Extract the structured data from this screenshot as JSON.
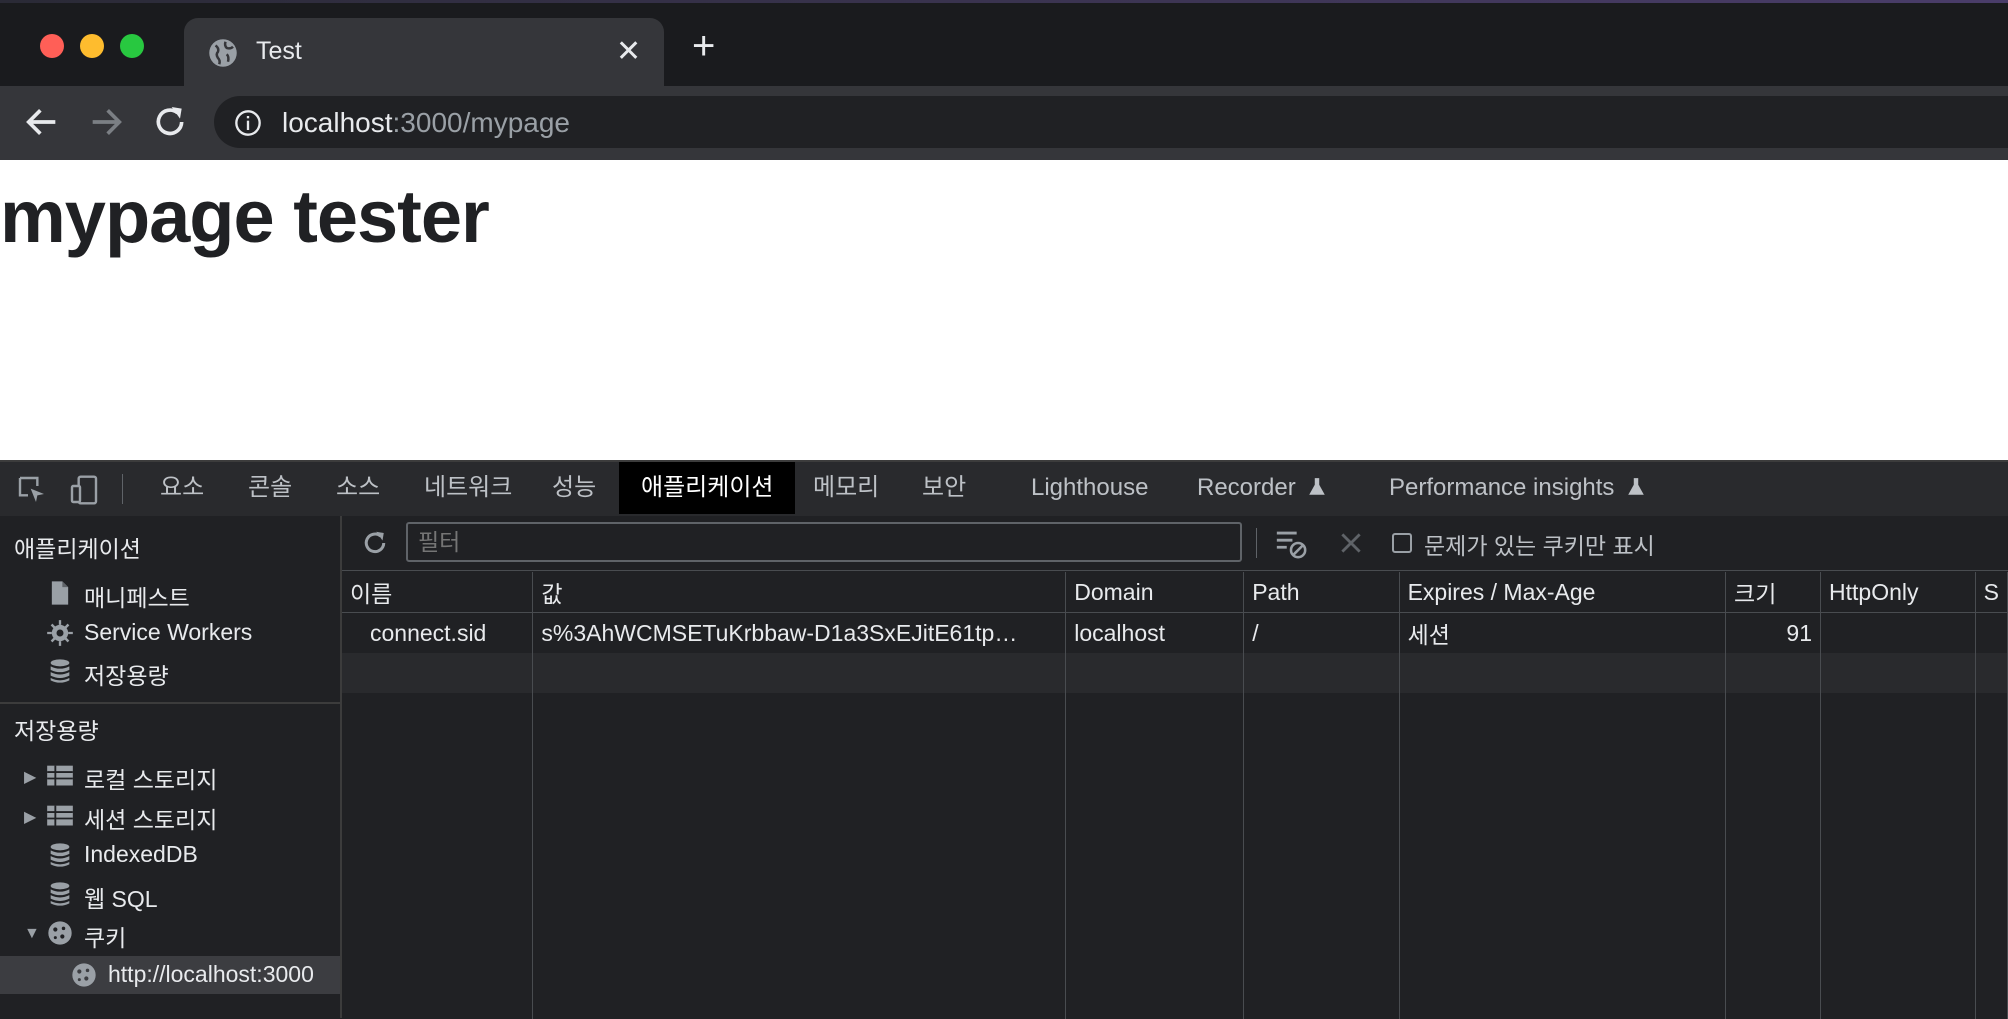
{
  "browser": {
    "tab_title": "Test",
    "tab_close": "✕",
    "new_tab": "+",
    "url_host": "localhost",
    "url_rest": ":3000/mypage"
  },
  "page": {
    "heading": "mypage tester"
  },
  "devtools": {
    "tabs": [
      "요소",
      "콘솔",
      "소스",
      "네트워크",
      "성능",
      "애플리케이션",
      "메모리",
      "보안",
      "Lighthouse",
      "Recorder",
      "Performance insights"
    ],
    "active_tab": "애플리케이션",
    "sidebar": {
      "section1": "애플리케이션",
      "app_items": [
        "매니페스트",
        "Service Workers",
        "저장용량"
      ],
      "section2": "저장용량",
      "storage_items": [
        "로컬 스토리지",
        "세션 스토리지",
        "IndexedDB",
        "웹 SQL",
        "쿠키"
      ],
      "cookie_origin": "http://localhost:3000"
    },
    "cookies": {
      "filter_placeholder": "필터",
      "issues_only_label": "문제가 있는 쿠키만 표시",
      "columns": [
        "이름",
        "값",
        "Domain",
        "Path",
        "Expires / Max-Age",
        "크기",
        "HttpOnly",
        "S"
      ],
      "rows": [
        [
          "connect.sid",
          "s%3AhWCMSETuKrbbaw-D1a3SxEJitE61tp…",
          "localhost",
          "/",
          "세션",
          "91",
          "",
          ""
        ]
      ]
    }
  },
  "colors": {
    "active_tab_bg": "#000000",
    "devtools_bg": "#202124"
  }
}
